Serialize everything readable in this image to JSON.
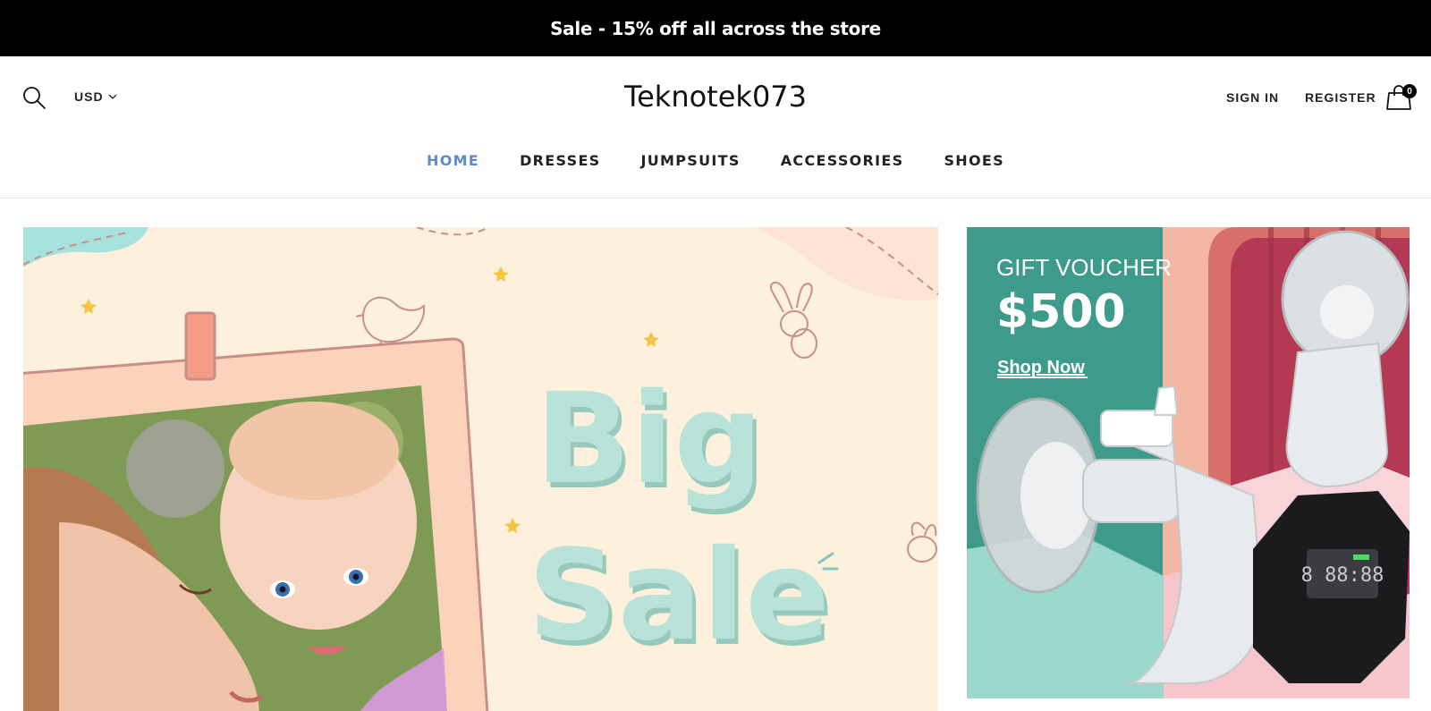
{
  "announcement": {
    "text": "Sale - 15% off all across the store"
  },
  "header": {
    "currency": "USD",
    "logo": "Teknotek073",
    "sign_in": "SIGN IN",
    "register": "REGISTER",
    "cart_count": "0",
    "icons": {
      "search": "search-icon",
      "cart": "shopping-bag-icon",
      "currency_caret": "chevron-down-icon"
    }
  },
  "nav": {
    "items": [
      {
        "label": "HOME",
        "active": true
      },
      {
        "label": "DRESSES",
        "active": false
      },
      {
        "label": "JUMPSUITS",
        "active": false
      },
      {
        "label": "ACCESSORIES",
        "active": false
      },
      {
        "label": "SHOES",
        "active": false
      }
    ],
    "active_color": "#5b8dc5"
  },
  "hero_banner": {
    "line1": "Big",
    "line2": "Sale",
    "text_color": "#b9e3d8",
    "background": "#fdf1dd"
  },
  "side_banner": {
    "title": "GIFT VOUCHER",
    "amount": "$500",
    "cta": "Shop Now",
    "panel_color": "#3e9a8b",
    "display": "8 88:88"
  }
}
